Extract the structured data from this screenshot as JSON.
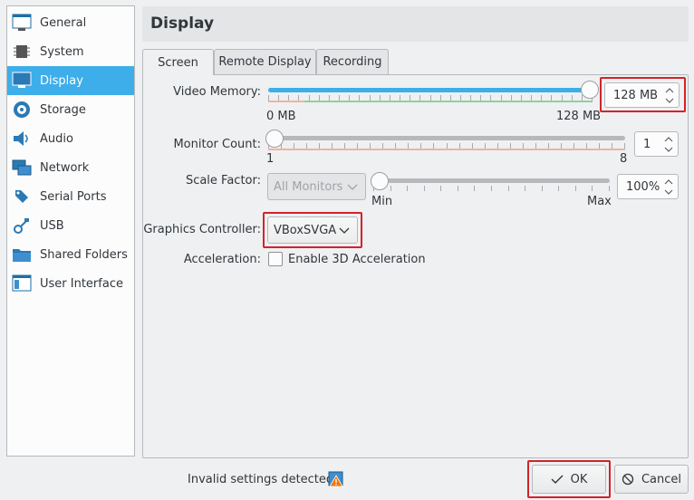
{
  "sidebar": {
    "items": [
      {
        "label": "General",
        "icon": "general-icon"
      },
      {
        "label": "System",
        "icon": "chip-icon"
      },
      {
        "label": "Display",
        "icon": "monitor-icon"
      },
      {
        "label": "Storage",
        "icon": "disk-icon"
      },
      {
        "label": "Audio",
        "icon": "speaker-icon"
      },
      {
        "label": "Network",
        "icon": "network-icon"
      },
      {
        "label": "Serial Ports",
        "icon": "serial-port-icon"
      },
      {
        "label": "USB",
        "icon": "usb-icon"
      },
      {
        "label": "Shared Folders",
        "icon": "folder-icon"
      },
      {
        "label": "User Interface",
        "icon": "window-icon"
      }
    ],
    "active": "Display"
  },
  "header": {
    "title": "Display"
  },
  "tabs": [
    {
      "label": "Screen",
      "active": true
    },
    {
      "label": "Remote Display",
      "active": false
    },
    {
      "label": "Recording",
      "active": false
    }
  ],
  "screen": {
    "video_memory": {
      "label": "Video Memory:",
      "min_label": "0 MB",
      "max_label": "128 MB",
      "value": "128 MB",
      "slider_fraction": 1.0
    },
    "monitor_count": {
      "label": "Monitor Count:",
      "min_label": "1",
      "max_label": "8",
      "value": "1",
      "slider_fraction": 0.0
    },
    "scale_factor": {
      "label": "Scale Factor:",
      "monitor_select": "All Monitors",
      "min_label": "Min",
      "max_label": "Max",
      "value": "100%",
      "slider_fraction": 0.0
    },
    "graphics_controller": {
      "label": "Graphics Controller:",
      "value": "VBoxSVGA"
    },
    "acceleration": {
      "label": "Acceleration:",
      "checkbox_label": "Enable 3D Acceleration",
      "checked": false
    }
  },
  "footer": {
    "warning_text": "Invalid settings detected",
    "ok_label": "OK",
    "cancel_label": "Cancel"
  },
  "colors": {
    "accent": "#3daee9",
    "highlight": "#d2232a",
    "ok_zone": "#8fd19e",
    "warn_zone": "#f0b49c"
  }
}
